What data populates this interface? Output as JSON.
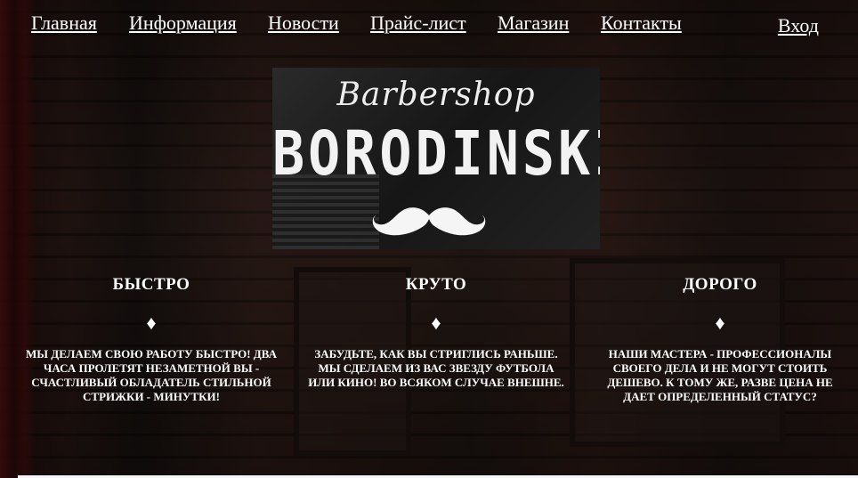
{
  "nav": {
    "items": [
      {
        "label": "Главная"
      },
      {
        "label": "Информация"
      },
      {
        "label": "Новости"
      },
      {
        "label": "Прайс-лист"
      },
      {
        "label": "Магазин"
      },
      {
        "label": "Контакты"
      }
    ],
    "login_label": "Вход"
  },
  "logo": {
    "script_text": "Barbershop",
    "brand_text": "BORODINSKI",
    "icon": "mustache-icon"
  },
  "features": [
    {
      "title": "БЫСТРО",
      "icon": "diamond-icon",
      "glyph": "♦",
      "text": "МЫ ДЕЛАЕМ СВОЮ РАБОТУ БЫСТРО! ДВА ЧАСА ПРОЛЕТЯТ НЕЗАМЕТНОЙ ВЫ - СЧАСТЛИВЫЙ ОБЛАДАТЕЛЬ СТИЛЬНОЙ СТРИЖКИ - МИНУТКИ!"
    },
    {
      "title": "КРУТО",
      "icon": "diamond-icon",
      "glyph": "♦",
      "text": "ЗАБУДЬТЕ, КАК ВЫ СТРИГЛИСЬ РАНЬШЕ. МЫ СДЕЛАЕМ ИЗ ВАС ЗВЕЗДУ ФУТБОЛА ИЛИ КИНО! ВО ВСЯКОМ СЛУЧАЕ ВНЕШНЕ."
    },
    {
      "title": "ДОРОГО",
      "icon": "diamond-icon",
      "glyph": "♦",
      "text": "НАШИ МАСТЕРА - ПРОФЕССИОНАЛЫ СВОЕГО ДЕЛА И НЕ МОГУТ СТОИТЬ ДЕШЕВО. К ТОМУ ЖЕ, РАЗВЕ ЦЕНА НЕ ДАЕТ ОПРЕДЕЛЕННЫЙ СТАТУС?"
    }
  ]
}
